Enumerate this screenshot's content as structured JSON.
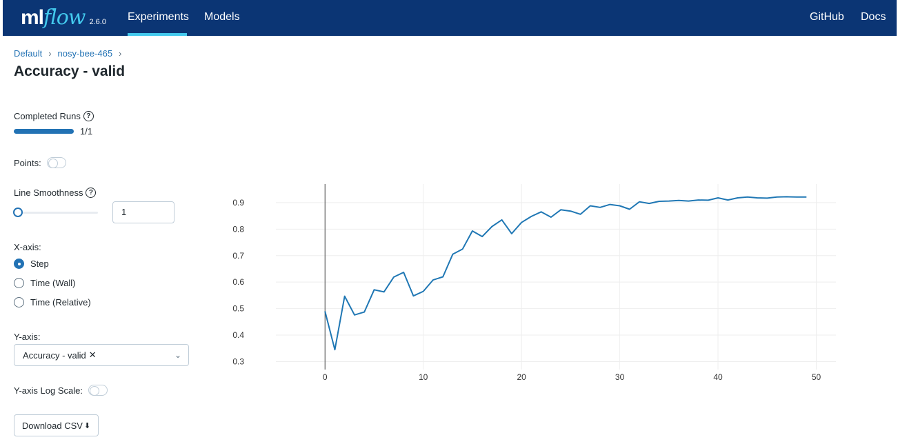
{
  "app": {
    "logo_ml": "ml",
    "logo_flow": "flow",
    "version": "2.6.0",
    "nav": [
      "Experiments",
      "Models"
    ],
    "nav_right": [
      "GitHub",
      "Docs"
    ],
    "colors": {
      "header": "#0b3574",
      "accent": "#43c9ed",
      "primary": "#2272b4"
    }
  },
  "breadcrumb": [
    "Default",
    "nosy-bee-465"
  ],
  "title": "Accuracy - valid",
  "controls": {
    "completed_runs_label": "Completed Runs",
    "completed_runs_progress": 1.0,
    "completed_runs_text": "1/1",
    "points_label": "Points:",
    "points_enabled": false,
    "smoothness_label": "Line Smoothness",
    "smoothness_value": "1",
    "xaxis_label": "X-axis:",
    "xaxis_options": [
      "Step",
      "Time (Wall)",
      "Time (Relative)"
    ],
    "xaxis_selected": "Step",
    "yaxis_label": "Y-axis:",
    "yaxis_selected": "Accuracy - valid",
    "ylog_label": "Y-axis Log Scale:",
    "ylog_enabled": false,
    "download_label": "Download CSV"
  },
  "icons": {
    "help": "question-circle-icon",
    "download": "download-icon",
    "chevron": "chevron-down-icon",
    "close": "close-icon",
    "separator": "chevron-right-icon"
  },
  "chart_data": {
    "type": "line",
    "title": "",
    "xlabel": "",
    "ylabel": "",
    "xlim": [
      -5,
      52
    ],
    "ylim": [
      0.27,
      0.97
    ],
    "x_ticks": [
      0,
      10,
      20,
      30,
      40,
      50
    ],
    "y_ticks": [
      0.3,
      0.4,
      0.5,
      0.6,
      0.7,
      0.8,
      0.9
    ],
    "grid": true,
    "series": [
      {
        "color": "#1f77b4",
        "x": [
          0,
          1,
          2,
          3,
          4,
          5,
          6,
          7,
          8,
          9,
          10,
          11,
          12,
          13,
          14,
          15,
          16,
          17,
          18,
          19,
          20,
          21,
          22,
          23,
          24,
          25,
          26,
          27,
          28,
          29,
          30,
          31,
          32,
          33,
          34,
          35,
          36,
          37,
          38,
          39,
          40,
          41,
          42,
          43,
          44,
          45,
          46,
          47,
          48,
          49
        ],
        "y": [
          0.49,
          0.345,
          0.547,
          0.476,
          0.487,
          0.571,
          0.563,
          0.619,
          0.637,
          0.548,
          0.565,
          0.608,
          0.62,
          0.705,
          0.725,
          0.793,
          0.772,
          0.81,
          0.835,
          0.783,
          0.825,
          0.848,
          0.865,
          0.845,
          0.873,
          0.868,
          0.856,
          0.888,
          0.882,
          0.893,
          0.888,
          0.875,
          0.903,
          0.897,
          0.905,
          0.906,
          0.908,
          0.906,
          0.91,
          0.909,
          0.918,
          0.91,
          0.918,
          0.921,
          0.918,
          0.917,
          0.921,
          0.922,
          0.921,
          0.921
        ]
      }
    ]
  }
}
